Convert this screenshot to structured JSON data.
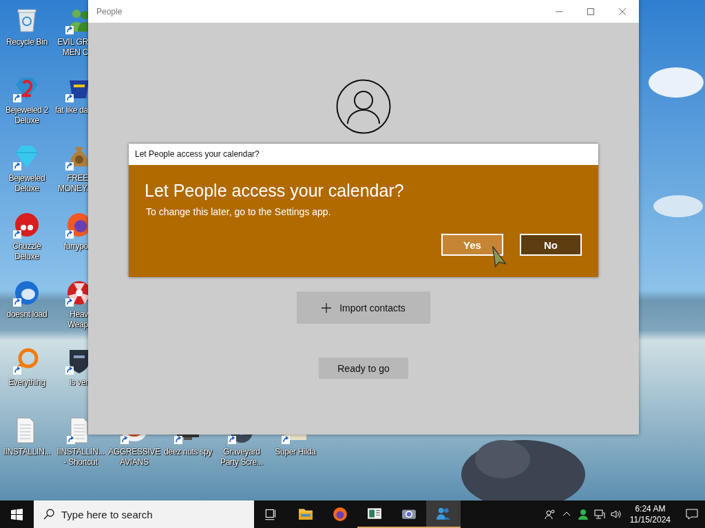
{
  "desktop": {
    "columns": [
      [
        {
          "label": "Recycle Bin",
          "kind": "bin",
          "shortcut": false
        },
        {
          "label": "Bejeweled 2\nDeluxe",
          "kind": "gem2",
          "shortcut": true
        },
        {
          "label": "Bejeweled\nDeluxe",
          "kind": "gem",
          "shortcut": true
        },
        {
          "label": "Chuzzle\nDeluxe",
          "kind": "fuzz",
          "shortcut": true
        },
        {
          "label": "doesnt load",
          "kind": "bird",
          "shortcut": true
        },
        {
          "label": "Everything",
          "kind": "ring",
          "shortcut": true
        }
      ],
      [
        {
          "label": "EVIL GR\nMEN C",
          "kind": "figures",
          "shortcut": true
        },
        {
          "label": "fat like da",
          "kind": "badge",
          "shortcut": true
        },
        {
          "label": "FREE\nMONEY.",
          "kind": "bag",
          "shortcut": true
        },
        {
          "label": "furrypo",
          "kind": "globe",
          "shortcut": true
        },
        {
          "label": "Heav\nWeap",
          "kind": "hazard",
          "shortcut": true
        },
        {
          "label": "is ver",
          "kind": "shield",
          "shortcut": true
        }
      ]
    ],
    "bottom_row": [
      {
        "label": "IINSTALLIN...",
        "kind": "doc",
        "shortcut": false
      },
      {
        "label": "IINSTALLIN...\n- Shortcut",
        "kind": "doc",
        "shortcut": true
      },
      {
        "label": "AGGRESSIVE\nAVIANS",
        "kind": "plate",
        "shortcut": true
      },
      {
        "label": "deez nuts spy",
        "kind": "screen",
        "shortcut": true
      },
      {
        "label": "Graveyard\nParty Scre...",
        "kind": "disc",
        "shortcut": true
      },
      {
        "label": "Super Hilda",
        "kind": "tiles",
        "shortcut": true
      }
    ]
  },
  "window": {
    "title": "People",
    "import_button": "Import contacts",
    "ready_button": "Ready to go"
  },
  "dialog": {
    "title": "Let People access your calendar?",
    "heading": "Let People access your calendar?",
    "message": "To change this later, go to the Settings app.",
    "buttons": [
      {
        "label": "Yes",
        "highlighted": true
      },
      {
        "label": "No",
        "highlighted": false
      }
    ]
  },
  "taskbar": {
    "search_placeholder": "Type here to search",
    "apps": [
      {
        "kind": "taskview",
        "running": false,
        "active": false
      },
      {
        "kind": "folder",
        "running": false,
        "active": false
      },
      {
        "kind": "browser",
        "running": false,
        "active": false
      },
      {
        "kind": "news",
        "running": true,
        "active": false
      },
      {
        "kind": "camera",
        "running": true,
        "active": false
      },
      {
        "kind": "people",
        "running": true,
        "active": true
      }
    ],
    "time": "6:24 AM",
    "date": "11/15/2024"
  }
}
